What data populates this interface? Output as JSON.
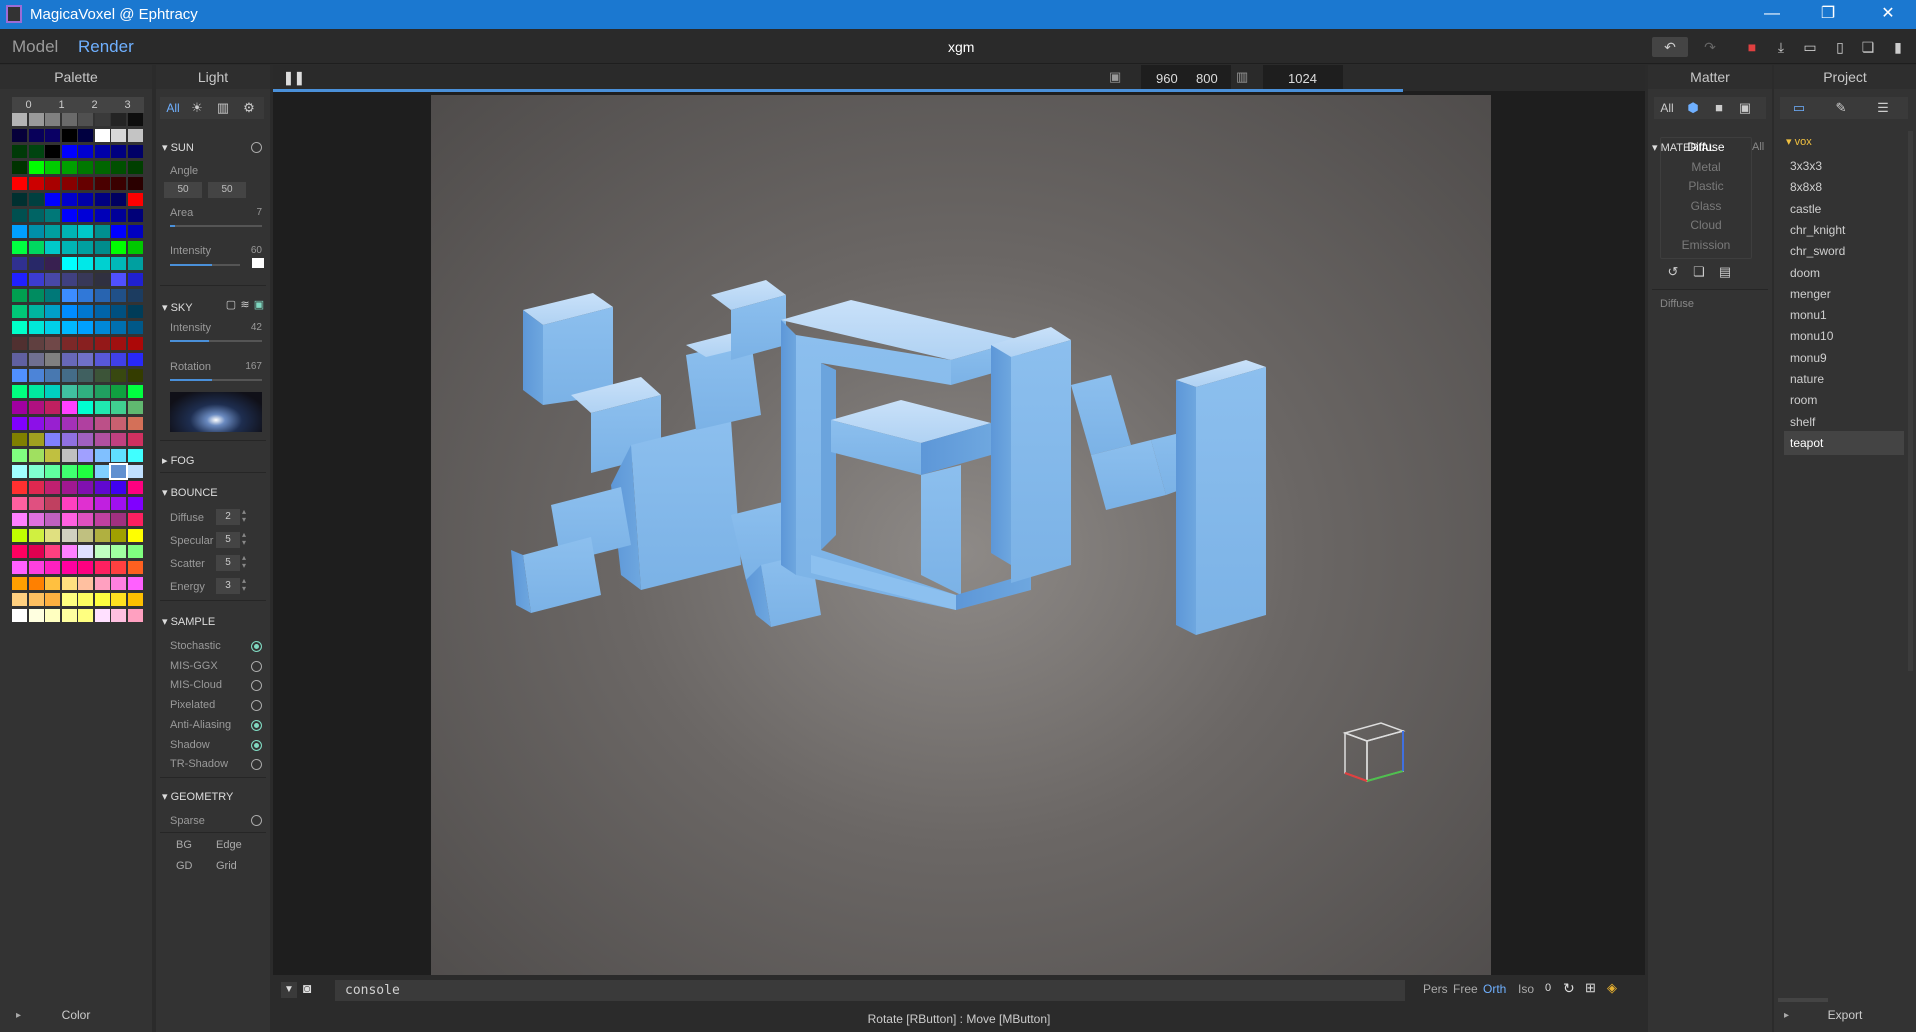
{
  "window": {
    "title": "MagicaVoxel @ Ephtracy",
    "minimize": "—",
    "restore": "❐",
    "close": "✕"
  },
  "menu": {
    "model": "Model",
    "render": "Render",
    "filename": "xgm"
  },
  "toolbar_icons": [
    "undo-icon",
    "redo-icon",
    "save-icon",
    "export-icon",
    "open-icon",
    "new-icon",
    "copy-icon",
    "delete-icon"
  ],
  "palette": {
    "title": "Palette",
    "tabs": [
      "0",
      "1",
      "2",
      "3"
    ],
    "footer": "Color",
    "colors": [
      "#b4b4b4",
      "#9a9a9a",
      "#808080",
      "#6a6a6a",
      "#505050",
      "#3a3a3a",
      "#242424",
      "#0e0e0e",
      "#06003a",
      "#08005a",
      "#0a0064",
      "#000000",
      "#000040",
      "#ffffff",
      "#d8d8d8",
      "#c4c4c4",
      "#003a08",
      "#004410",
      "#000000",
      "#0000ff",
      "#0000d0",
      "#0000a8",
      "#000080",
      "#000066",
      "#003300",
      "#00ff00",
      "#00cc00",
      "#00a000",
      "#007800",
      "#006600",
      "#005000",
      "#003f00",
      "#ff0000",
      "#cc0000",
      "#a80000",
      "#880000",
      "#660000",
      "#4a0000",
      "#3a0000",
      "#2a0000",
      "#003030",
      "#004040",
      "#0000ff",
      "#0000cc",
      "#0000a8",
      "#000080",
      "#000060",
      "#ff0000",
      "#005050",
      "#006464",
      "#007878",
      "#0000ff",
      "#0000d8",
      "#0000b8",
      "#000098",
      "#000078",
      "#00a0ff",
      "#0090a8",
      "#00a0a0",
      "#00b4b4",
      "#00c8c8",
      "#009090",
      "#0000ff",
      "#0000c0",
      "#00ff40",
      "#00d860",
      "#00c8c8",
      "#00b4b4",
      "#00a0a0",
      "#008c8c",
      "#00ff00",
      "#00c800",
      "#303090",
      "#282868",
      "#382050",
      "#00ffff",
      "#00e8e8",
      "#00d0d0",
      "#00b8b8",
      "#00a0a0",
      "#2020ff",
      "#3c3cd0",
      "#4848a8",
      "#404080",
      "#383858",
      "#303040",
      "#5050ff",
      "#2020d0",
      "#00a050",
      "#008c60",
      "#007878",
      "#3c8cff",
      "#3078d8",
      "#2864b0",
      "#205088",
      "#1c3c60",
      "#00c878",
      "#00b4a0",
      "#00a0c8",
      "#008cff",
      "#0078d0",
      "#0064a8",
      "#005080",
      "#003c58",
      "#00ffc8",
      "#00e8d8",
      "#00d0e8",
      "#00b8ff",
      "#00a0ff",
      "#0088d8",
      "#0070b0",
      "#005888",
      "#503030",
      "#604040",
      "#704848",
      "#7c2828",
      "#882020",
      "#941818",
      "#a01010",
      "#ac0808",
      "#6060a0",
      "#707090",
      "#808080",
      "#6868b8",
      "#7070c8",
      "#5858d8",
      "#4040e8",
      "#2828f8",
      "#5090ff",
      "#4c84d8",
      "#4878b0",
      "#446c88",
      "#406060",
      "#3c5438",
      "#384810",
      "#343c00",
      "#00ff80",
      "#00e8a0",
      "#00d0c0",
      "#40c0a0",
      "#30b080",
      "#20a060",
      "#10a040",
      "#00ff40",
      "#a000a0",
      "#b01080",
      "#c02060",
      "#ff40ff",
      "#00ffd0",
      "#20e8b0",
      "#40d090",
      "#60b870",
      "#8000ff",
      "#8c10e8",
      "#9820d0",
      "#a430b8",
      "#b040a0",
      "#bc5088",
      "#c86070",
      "#d47058",
      "#808000",
      "#a0a020",
      "#8080ff",
      "#9070e0",
      "#a060c0",
      "#b050a0",
      "#c04080",
      "#d03060",
      "#80ff80",
      "#a0e060",
      "#c0c040",
      "#c0c0c0",
      "#a0a0ff",
      "#80c0ff",
      "#60e0ff",
      "#40ffff",
      "#a0ffff",
      "#80ffd0",
      "#60ffa0",
      "#40ff70",
      "#20ff40",
      "#80d0ff",
      "#6090d0",
      "#c0e0ff",
      "#ff3030",
      "#e02850",
      "#c02070",
      "#a01890",
      "#8010b0",
      "#6008d0",
      "#4000f0",
      "#ff0080",
      "#ff60a0",
      "#e05080",
      "#c04060",
      "#ff40c0",
      "#e030d0",
      "#c020e0",
      "#a010f0",
      "#8000ff",
      "#ff80ff",
      "#e070e0",
      "#c060c0",
      "#ff60e0",
      "#e050c0",
      "#c040a0",
      "#a03080",
      "#ff2060",
      "#c0ff00",
      "#d0f040",
      "#e0e080",
      "#d0d0c0",
      "#c0c080",
      "#b0b040",
      "#a0a000",
      "#ffff00",
      "#ff0060",
      "#e00050",
      "#ff4080",
      "#ff80ff",
      "#e0e0ff",
      "#c0ffc0",
      "#a0ffa0",
      "#80ff80",
      "#ff60ff",
      "#ff40e0",
      "#ff20c0",
      "#ff00a0",
      "#ff0080",
      "#ff2060",
      "#ff4040",
      "#ff6020",
      "#ffa000",
      "#ff8000",
      "#ffc040",
      "#ffe080",
      "#ffc0a0",
      "#ffa0c0",
      "#ff80e0",
      "#ff60ff",
      "#ffd080",
      "#ffc060",
      "#ffb040",
      "#ffff80",
      "#ffff60",
      "#ffff40",
      "#ffe020",
      "#ffc000",
      "#ffffff",
      "#ffffe0",
      "#ffffc0",
      "#ffffa0",
      "#ffff80",
      "#ffe0ff",
      "#ffc0e0",
      "#ffa0c0"
    ],
    "selected_index": 182
  },
  "light": {
    "title": "Light",
    "tab_all": "All",
    "sun": {
      "label": "SUN",
      "angle_label": "Angle",
      "angle1": "50",
      "angle2": "50",
      "area_label": "Area",
      "area": "7",
      "area_level": 0.05,
      "intensity_label": "Intensity",
      "intensity": "60",
      "intensity_level": 0.6
    },
    "sky": {
      "label": "SKY",
      "intensity_label": "Intensity",
      "intensity": "42",
      "intensity_level": 0.42,
      "rotation_label": "Rotation",
      "rotation": "167",
      "rotation_level": 0.46
    },
    "fog": {
      "label": "FOG"
    },
    "bounce": {
      "label": "BOUNCE",
      "diffuse_label": "Diffuse",
      "diffuse": "2",
      "specular_label": "Specular",
      "specular": "5",
      "scatter_label": "Scatter",
      "scatter": "5",
      "energy_label": "Energy",
      "energy": "3"
    },
    "sample": {
      "label": "SAMPLE",
      "items": [
        {
          "label": "Stochastic",
          "on": true
        },
        {
          "label": "MIS-GGX",
          "on": false
        },
        {
          "label": "MIS-Cloud",
          "on": false
        },
        {
          "label": "Pixelated",
          "on": false
        },
        {
          "label": "Anti-Aliasing",
          "on": true
        },
        {
          "label": "Shadow",
          "on": true
        },
        {
          "label": "TR-Shadow",
          "on": false
        }
      ]
    },
    "geometry": {
      "label": "GEOMETRY",
      "sparse": "Sparse",
      "bg": "BG",
      "edge": "Edge",
      "gd": "GD",
      "grid": "Grid"
    }
  },
  "viewport": {
    "width": "960",
    "height": "800",
    "samples": "1024",
    "console_placeholder": "console",
    "view_modes": [
      "Pers",
      "Free",
      "Orth",
      "Iso"
    ],
    "active_view": "Orth",
    "rotation_value": "0",
    "status": "Rotate [RButton] : Move [MButton]",
    "progress": 0.82
  },
  "matter": {
    "title": "Matter",
    "tab_all": "All",
    "material_label": "MATERIAL",
    "material_all": "All",
    "materials": [
      "Diffuse",
      "Metal",
      "Plastic",
      "Glass",
      "Cloud",
      "Emission"
    ],
    "selected_material": "Diffuse",
    "current": "Diffuse"
  },
  "project": {
    "title": "Project",
    "folder": "vox",
    "items": [
      "3x3x3",
      "8x8x8",
      "castle",
      "chr_knight",
      "chr_sword",
      "doom",
      "menger",
      "monu1",
      "monu10",
      "monu9",
      "nature",
      "room",
      "shelf",
      "teapot"
    ],
    "selected": "teapot",
    "export": "Export"
  }
}
